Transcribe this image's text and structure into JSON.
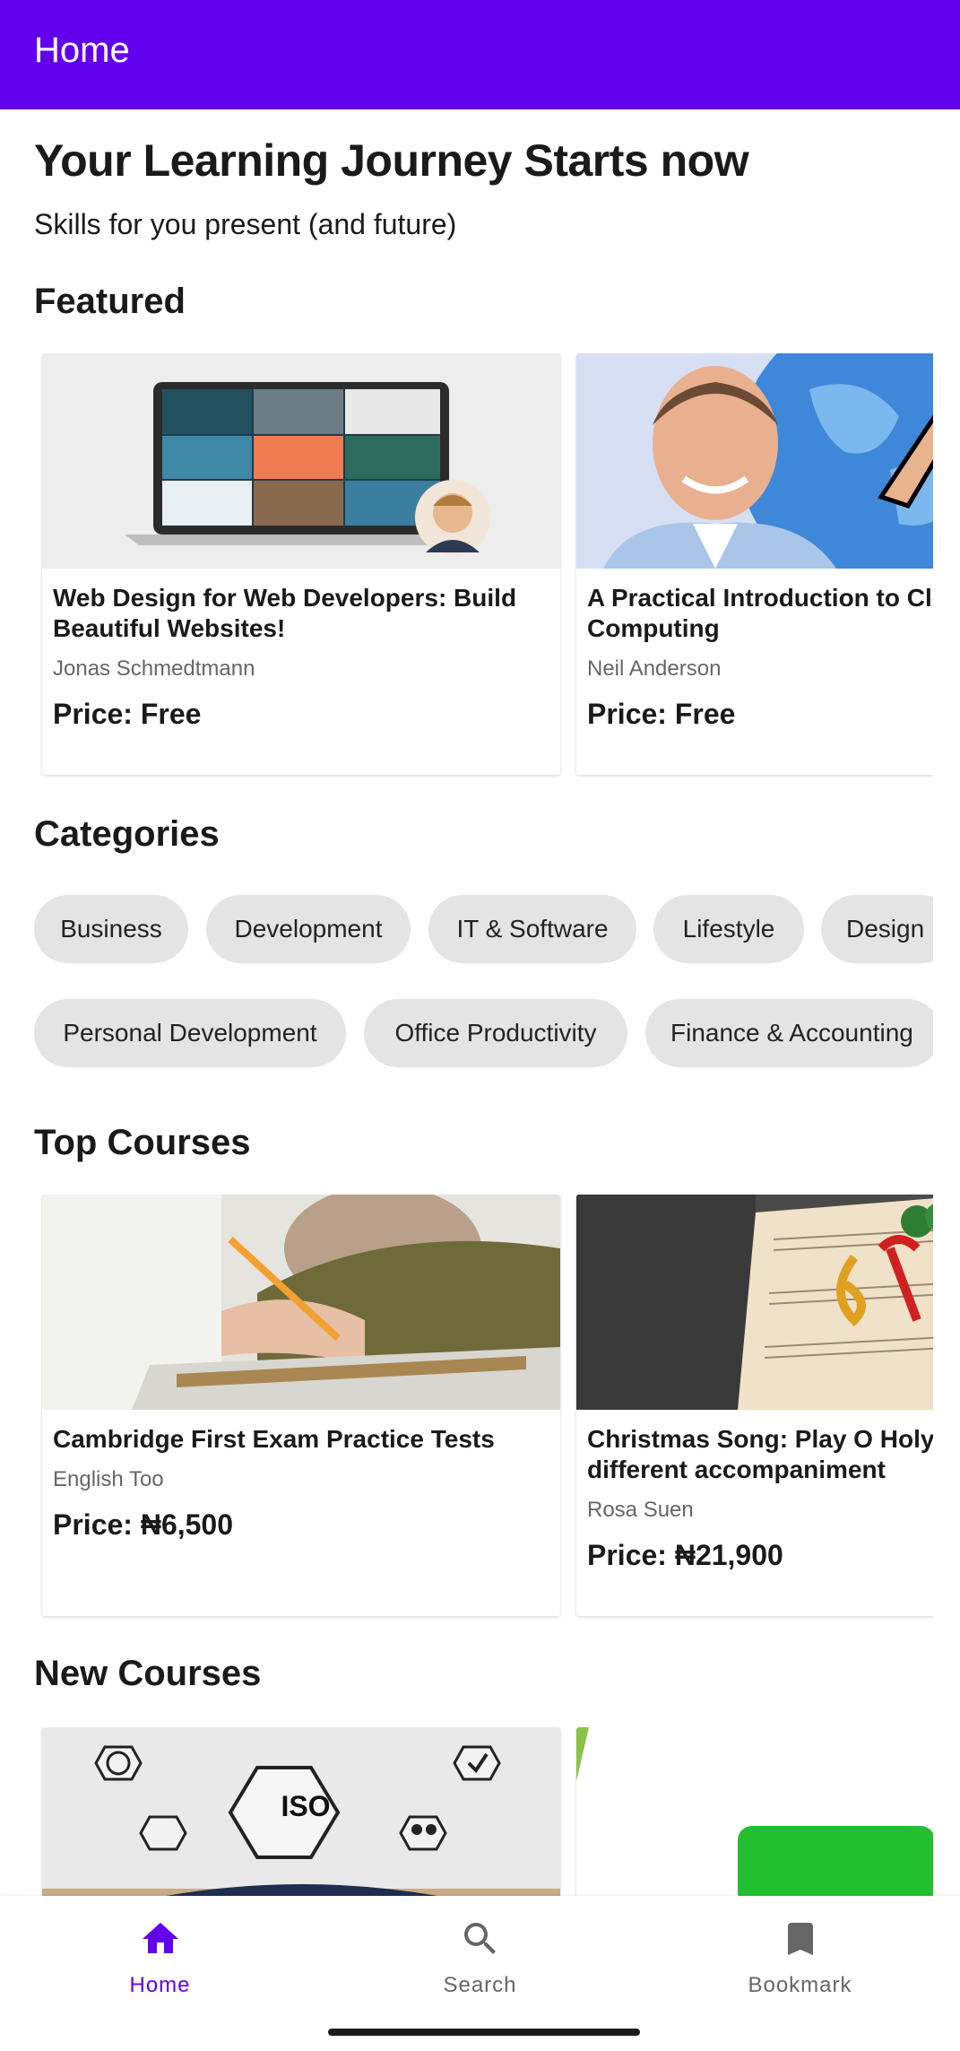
{
  "app": {
    "title": "Home"
  },
  "hero": {
    "title": "Your Learning Journey Starts now",
    "subtitle": "Skills for you present (and future)"
  },
  "featured": {
    "title": "Featured",
    "courses": [
      {
        "title": "Web Design for Web Developers: Build\nBeautiful Websites!",
        "author": "Jonas Schmedtmann",
        "price": "Price: Free"
      },
      {
        "title": "A Practical Introduction to Cloud\nComputing",
        "author": "Neil Anderson",
        "price": "Price: Free"
      }
    ]
  },
  "categories": {
    "title": "Categories",
    "row1": [
      "Business",
      "Development",
      "IT & Software",
      "Lifestyle",
      "Design"
    ],
    "row2": [
      "Personal Development",
      "Office Productivity",
      "Finance & Accounting"
    ]
  },
  "top_courses": {
    "title": "Top Courses",
    "courses": [
      {
        "title": "Cambridge First Exam Practice Tests",
        "author": "English Too",
        "price": "Price: ₦6,500"
      },
      {
        "title": "Christmas Song:  Play O Holy Night\ndifferent accompaniment",
        "author": "Rosa Suen",
        "price": "Price: ₦21,900"
      }
    ]
  },
  "new_courses": {
    "title": "New Courses",
    "iso_label": "ISO"
  },
  "bottom_nav": {
    "items": [
      {
        "label": "Home",
        "icon": "home-icon",
        "active": true
      },
      {
        "label": "Search",
        "icon": "search-icon",
        "active": false
      },
      {
        "label": "Bookmark",
        "icon": "bookmark-icon",
        "active": false
      }
    ]
  },
  "colors": {
    "primary": "#6200ee",
    "chip_bg": "#e4e4e4",
    "inactive": "#666666"
  }
}
